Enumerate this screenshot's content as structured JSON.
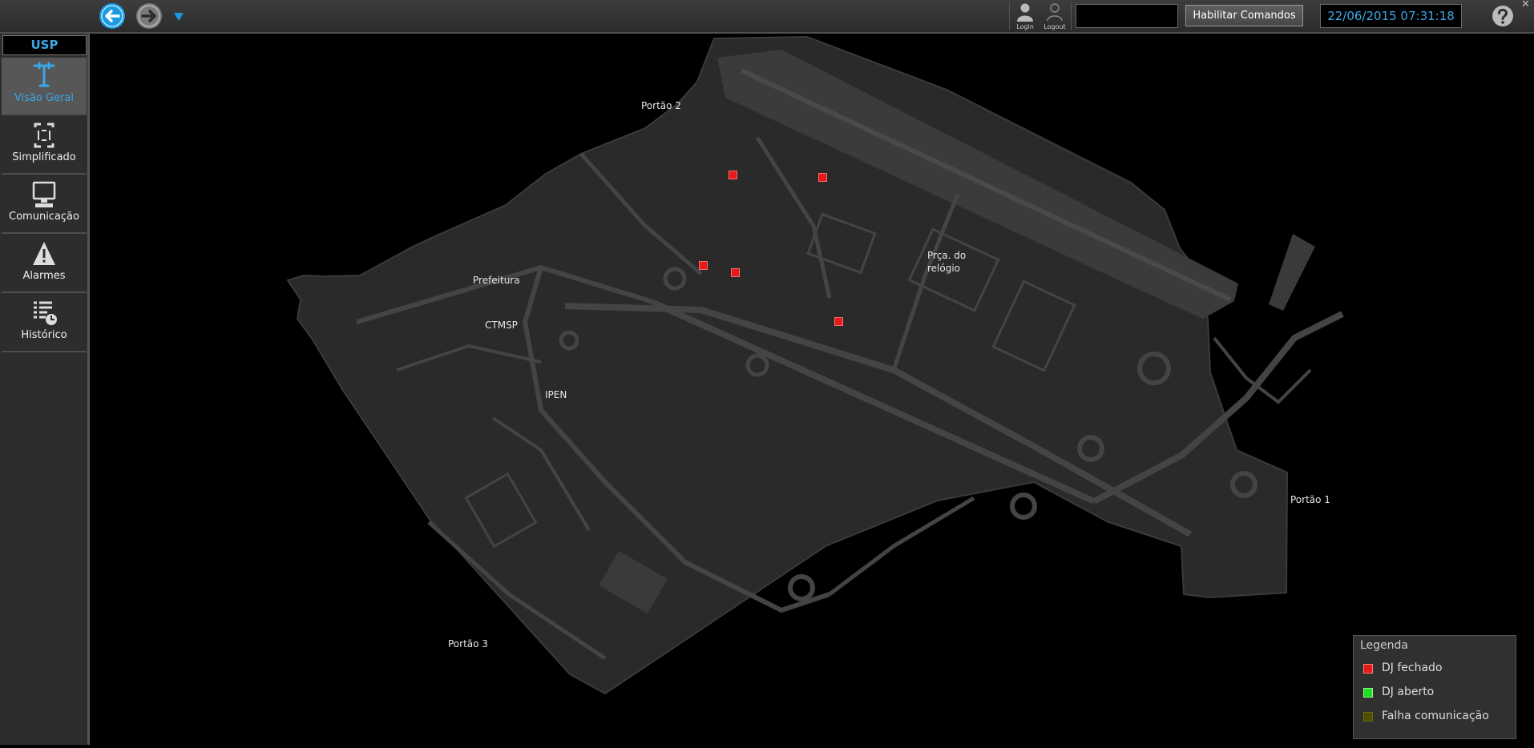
{
  "window": {
    "close_glyph": "✕"
  },
  "toolbar": {
    "login_label": "Login",
    "logout_label": "Logout",
    "command_input_value": "",
    "enable_commands_label": "Habilitar Comandos",
    "datetime": "22/06/2015 07:31:18",
    "accent_color": "#1a9be0"
  },
  "sidebar": {
    "site": "USP",
    "items": [
      {
        "label": "Visão Geral",
        "icon": "network-icon",
        "active": true
      },
      {
        "label": "Simplificado",
        "icon": "simplified-icon",
        "active": false
      },
      {
        "label": "Comunicação",
        "icon": "monitor-icon",
        "active": false
      },
      {
        "label": "Alarmes",
        "icon": "warning-icon",
        "active": false
      },
      {
        "label": "Histórico",
        "icon": "history-icon",
        "active": false
      }
    ]
  },
  "map": {
    "labels": {
      "portao2": "Portão 2",
      "portao1": "Portão 1",
      "portao3": "Portão 3",
      "prefeitura": "Prefeitura",
      "ctmsp": "CTMSP",
      "ipen": "IPEN",
      "praca": "Prça. do relógio"
    },
    "breaker_status": [
      "DJ fechado",
      "DJ fechado",
      "DJ fechado",
      "DJ fechado",
      "DJ fechado"
    ]
  },
  "legend": {
    "title": "Legenda",
    "items": [
      {
        "label": "DJ fechado",
        "color": "#e51a1a"
      },
      {
        "label": "DJ aberto",
        "color": "#22dd22"
      },
      {
        "label": "Falha comunicação",
        "color": "#4e4e00"
      }
    ]
  }
}
